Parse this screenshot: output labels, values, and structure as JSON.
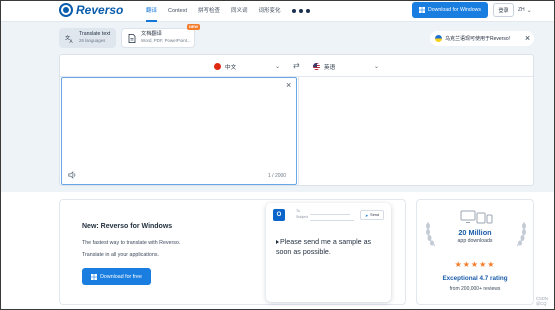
{
  "brand": {
    "name": "Reverso"
  },
  "nav": {
    "items": [
      "翻译",
      "Context",
      "拼写检查",
      "同义词",
      "词形变化"
    ],
    "active_index": 0
  },
  "header": {
    "download_label": "Download for Windows",
    "login_label": "登录",
    "lang_label": "ZH"
  },
  "mode_tabs": {
    "text": {
      "title": "Translate text",
      "subtitle": "26 languages"
    },
    "document": {
      "title": "文档翻译",
      "subtitle": "Word, PDF, PowerPoint...",
      "badge": "NEW"
    }
  },
  "promo_banner": {
    "text": "乌克兰语现可使用于Reverso!"
  },
  "translator": {
    "source_language": "中文",
    "target_language": "英语",
    "source_text": "",
    "char_counter": "1 / 2000"
  },
  "windows_promo": {
    "title": "New: Reverso for Windows",
    "line1": "The fastest way to translate with Reverso.",
    "line2": "Translate in all your applications.",
    "button_label": "Download for free"
  },
  "mail_preview": {
    "icon_letter": "O",
    "to_label": "To",
    "subject_label": "Subject",
    "send_label": "Send",
    "body": "Please send me a sample as soon as possible."
  },
  "stats": {
    "downloads_value": "20 Million",
    "downloads_label": "app downloads",
    "star_count": 5,
    "rating_label": "Exceptional 4.7 rating",
    "reviews_label": "from 200,000+ reviews"
  },
  "watermark": {
    "line1": "CSDN",
    "line2": "@CQ"
  },
  "colors": {
    "primary": "#1a7de0",
    "brand": "#0b5cad",
    "accent_orange": "#f47b2a",
    "page_bg": "#eef3f8"
  }
}
